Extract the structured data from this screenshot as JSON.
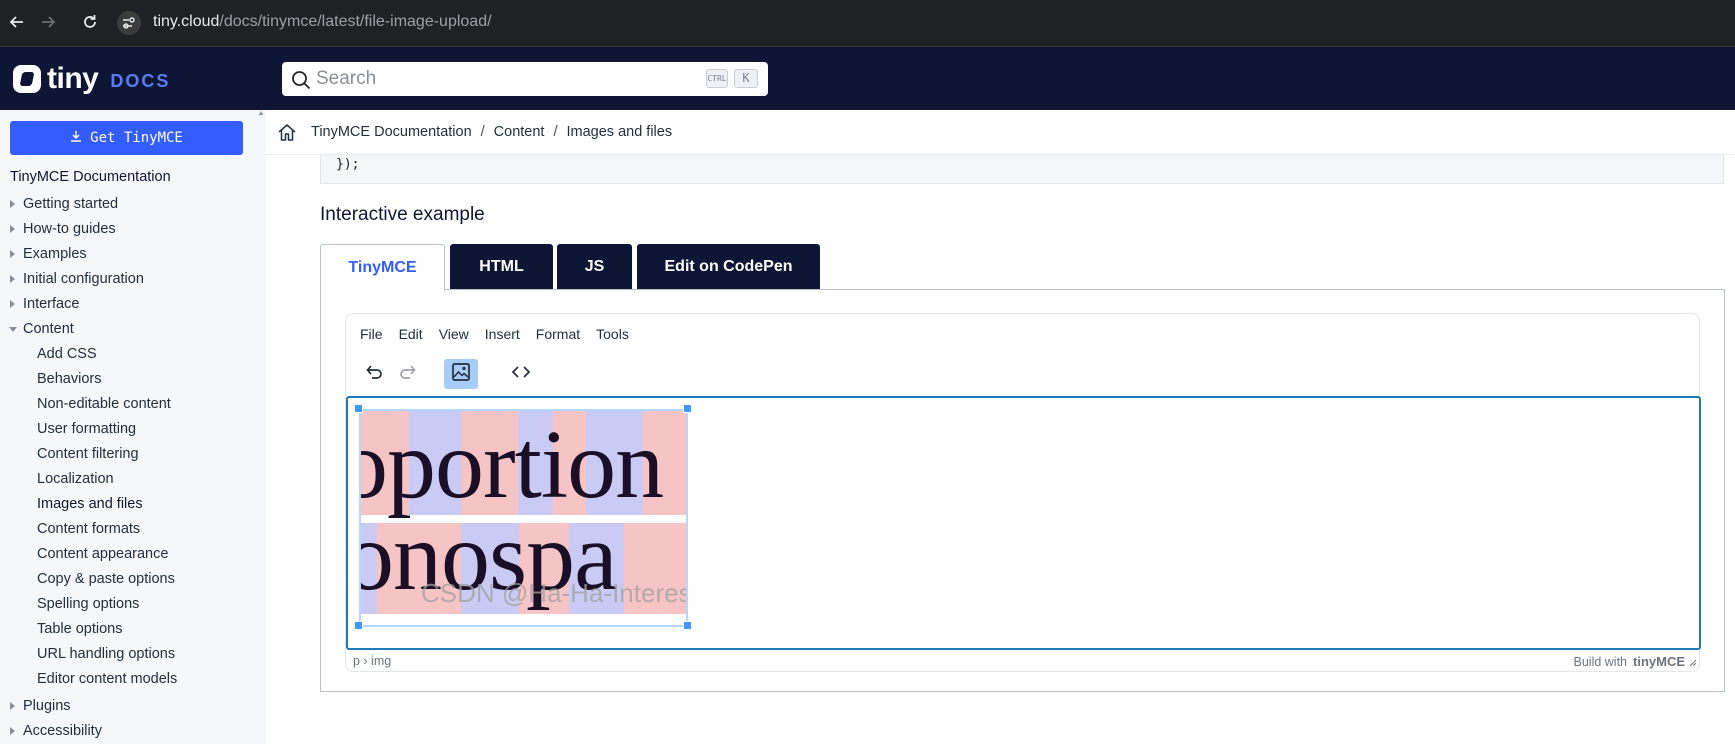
{
  "browser": {
    "url_host": "tiny.cloud",
    "url_path": "/docs/tinymce/latest/file-image-upload/"
  },
  "header": {
    "logo_text": "tiny",
    "logo_docs": "DOCS",
    "search_placeholder": "Search",
    "kbd_ctrl": "CTRL",
    "kbd_k": "K"
  },
  "sidebar": {
    "get_button": "Get TinyMCE",
    "root": "TinyMCE Documentation",
    "top_items": [
      {
        "label": "Getting started"
      },
      {
        "label": "How-to guides"
      },
      {
        "label": "Examples"
      },
      {
        "label": "Initial configuration"
      },
      {
        "label": "Interface"
      },
      {
        "label": "Content"
      }
    ],
    "content_items": [
      {
        "label": "Add CSS"
      },
      {
        "label": "Behaviors"
      },
      {
        "label": "Non-editable content"
      },
      {
        "label": "User formatting"
      },
      {
        "label": "Content filtering"
      },
      {
        "label": "Localization"
      },
      {
        "label": "Images and files"
      },
      {
        "label": "Content formats"
      },
      {
        "label": "Content appearance"
      },
      {
        "label": "Copy & paste options"
      },
      {
        "label": "Spelling options"
      },
      {
        "label": "Table options"
      },
      {
        "label": "URL handling options"
      },
      {
        "label": "Editor content models"
      }
    ],
    "bottom_items": [
      {
        "label": "Plugins"
      },
      {
        "label": "Accessibility"
      }
    ]
  },
  "breadcrumb": {
    "items": [
      "TinyMCE Documentation",
      "Content",
      "Images and files"
    ],
    "separator": "/"
  },
  "content": {
    "code_tail": "});",
    "section_title": "Interactive example",
    "tabs": [
      "TinyMCE",
      "HTML",
      "JS",
      "Edit on CodePen"
    ],
    "active_tab": "TinyMCE"
  },
  "editor": {
    "menu": [
      "File",
      "Edit",
      "View",
      "Insert",
      "Format",
      "Tools"
    ],
    "toolbar": [
      "undo-icon",
      "redo-icon",
      "image-icon",
      "code-icon"
    ],
    "image_text_line1": "oportion",
    "image_text_line2": "onospa",
    "image_watermark": "CSDN @Ha-Ha-Interest",
    "status_path": "p › img",
    "build_with": "Build with",
    "brand": "tinyMCE"
  },
  "colors": {
    "header_bg": "#0d1735",
    "accent_blue": "#335dff",
    "editor_focus": "#207ab7",
    "stripe_pink": "#f7c4c6",
    "stripe_lavender": "#c9cbf5"
  }
}
